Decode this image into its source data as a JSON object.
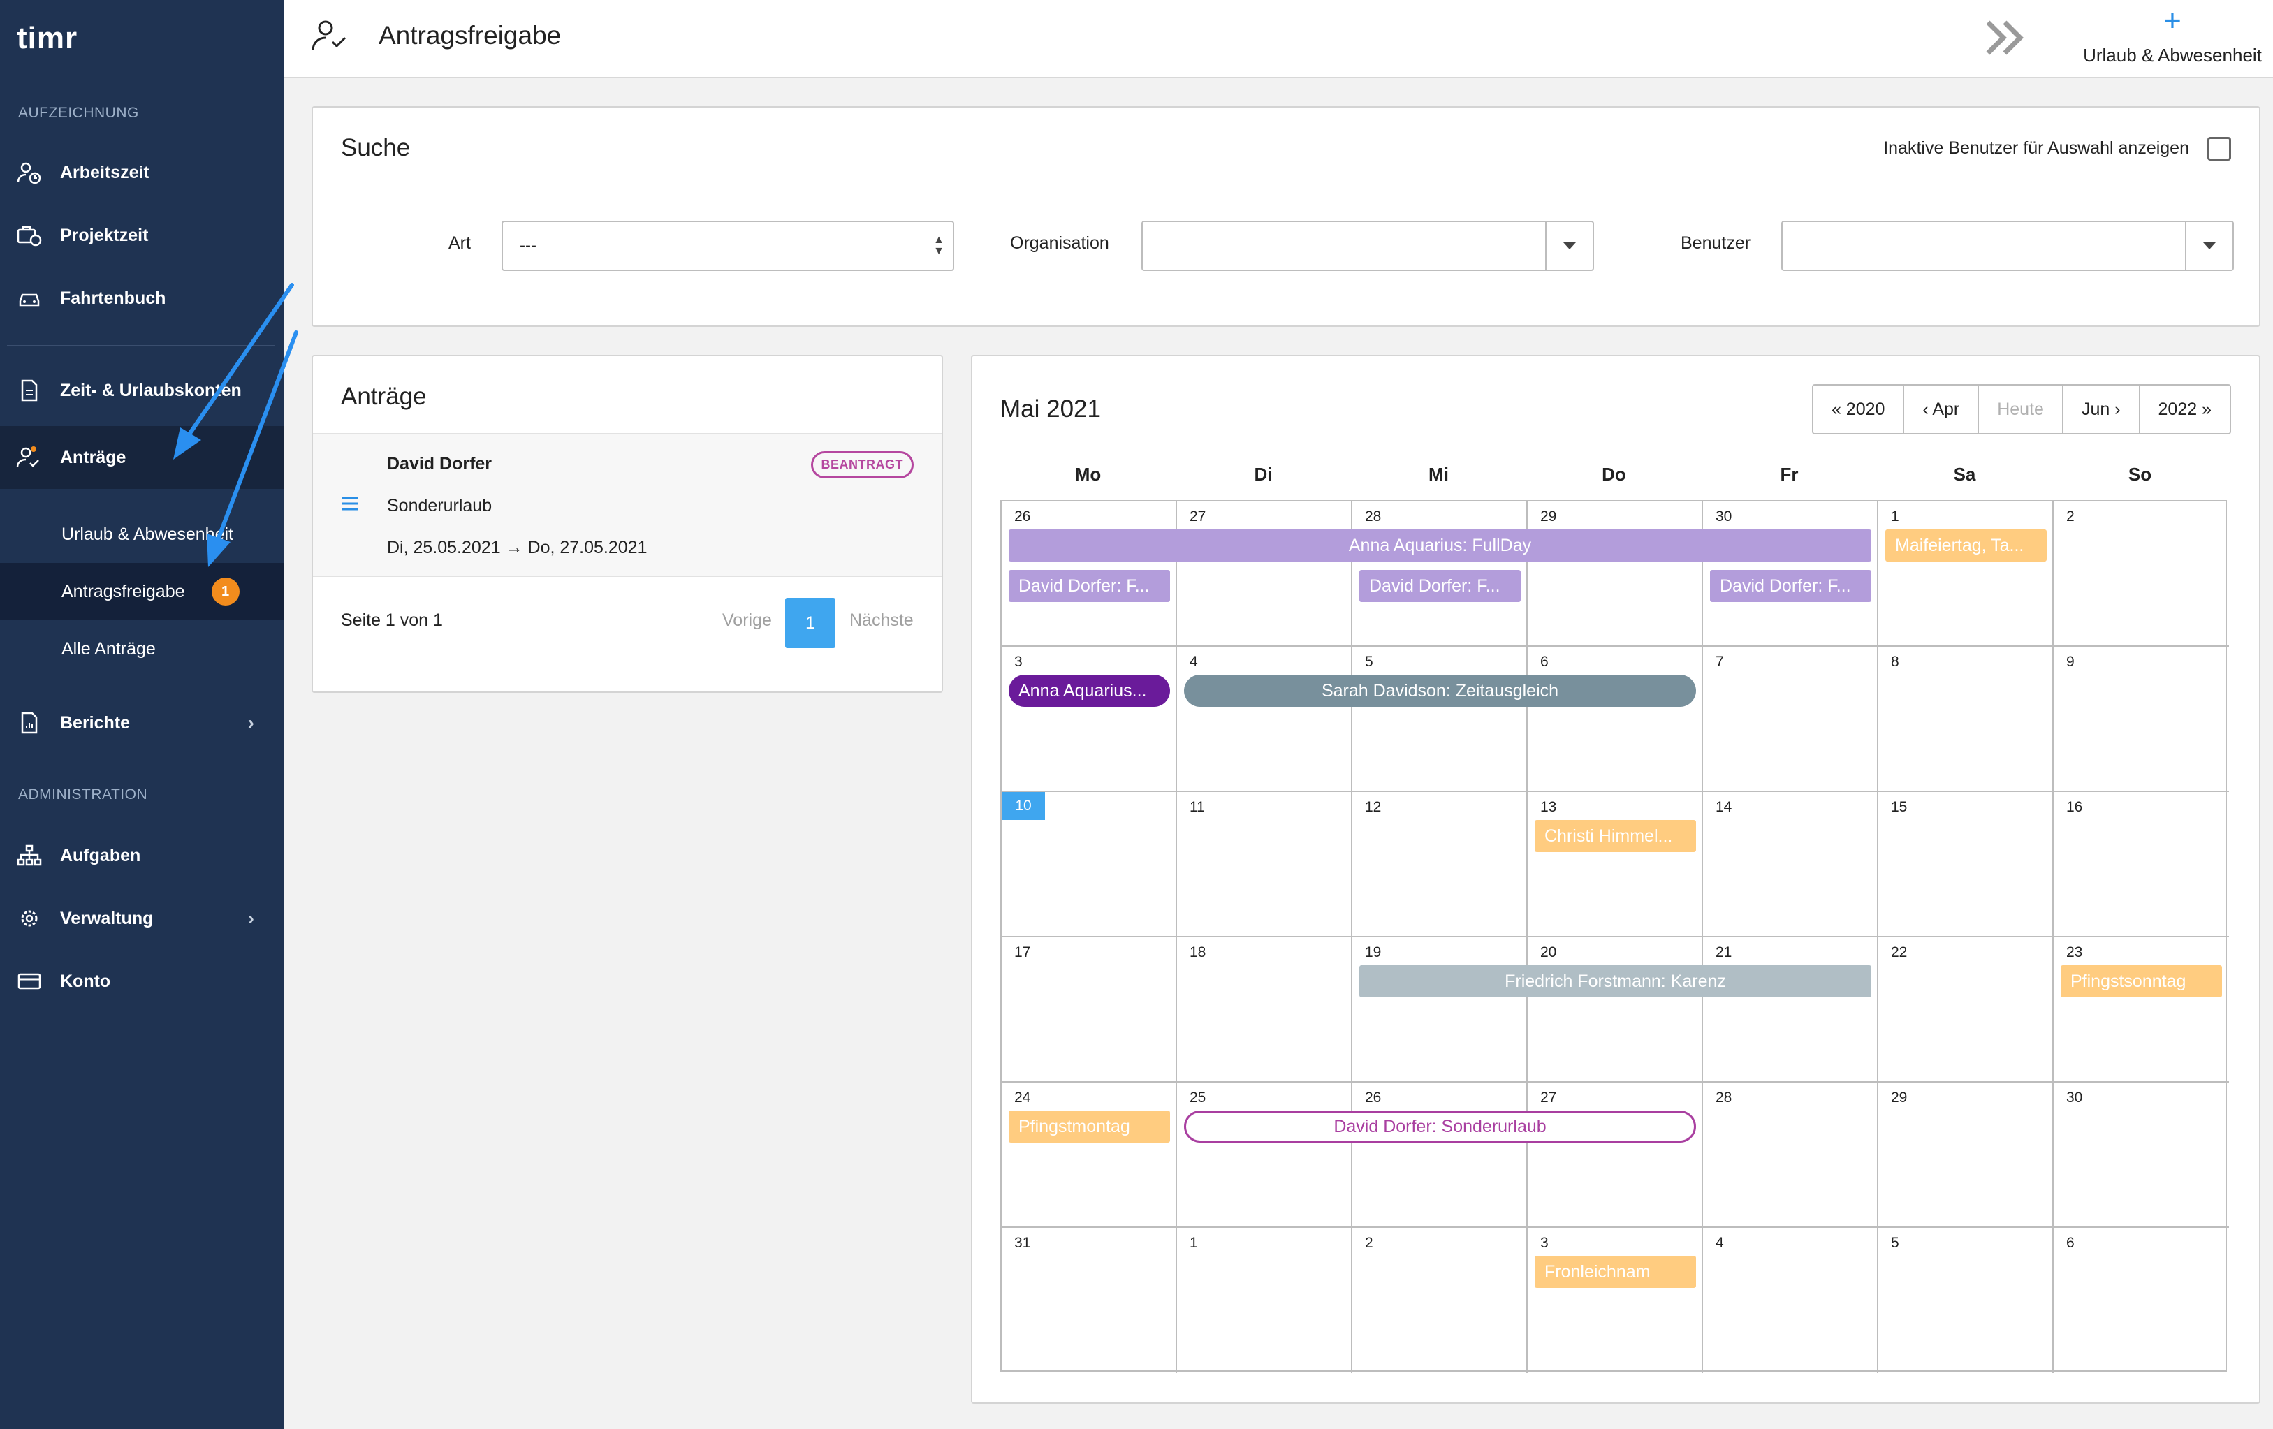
{
  "sidebar": {
    "logo": "timr",
    "section_recording": "AUFZEICHNUNG",
    "section_admin": "ADMINISTRATION",
    "items": {
      "arbeitszeit": "Arbeitszeit",
      "projektzeit": "Projektzeit",
      "fahrtenbuch": "Fahrtenbuch",
      "konten": "Zeit- & Urlaubskonten",
      "antraege": "Anträge",
      "urlaub": "Urlaub & Abwesenheit",
      "antragsfreigabe": "Antragsfreigabe",
      "antragsfreigabe_badge": "1",
      "alle": "Alle Anträge",
      "berichte": "Berichte",
      "aufgaben": "Aufgaben",
      "verwaltung": "Verwaltung",
      "konto": "Konto"
    }
  },
  "topbar": {
    "title": "Antragsfreigabe",
    "add_label": "Urlaub & Abwesenheit",
    "add_icon": "+"
  },
  "search": {
    "title": "Suche",
    "inactive_label": "Inaktive Benutzer für Auswahl anzeigen",
    "art_label": "Art",
    "art_value": "---",
    "org_label": "Organisation",
    "org_value": "",
    "user_label": "Benutzer",
    "user_value": ""
  },
  "requests": {
    "title": "Anträge",
    "item": {
      "name": "David Dorfer",
      "status": "BEANTRAGT",
      "type": "Sonderurlaub",
      "dates": "Di, 25.05.2021 → Do, 27.05.2021"
    },
    "pager": {
      "info": "Seite 1 von 1",
      "prev": "Vorige",
      "current": "1",
      "next": "Nächste"
    }
  },
  "calendar": {
    "title": "Mai 2021",
    "nav": {
      "prev_year": "« 2020",
      "prev_month": "‹ Apr",
      "today": "Heute",
      "next_month": "Jun ›",
      "next_year": "2022 »"
    },
    "weekdays": [
      "Mo",
      "Di",
      "Mi",
      "Do",
      "Fr",
      "Sa",
      "So"
    ],
    "weeks": [
      [
        "26",
        "27",
        "28",
        "29",
        "30",
        "1",
        "2"
      ],
      [
        "3",
        "4",
        "5",
        "6",
        "7",
        "8",
        "9"
      ],
      [
        "10",
        "11",
        "12",
        "13",
        "14",
        "15",
        "16"
      ],
      [
        "17",
        "18",
        "19",
        "20",
        "21",
        "22",
        "23"
      ],
      [
        "24",
        "25",
        "26",
        "27",
        "28",
        "29",
        "30"
      ],
      [
        "31",
        "1",
        "2",
        "3",
        "4",
        "5",
        "6"
      ]
    ],
    "today_label": "10",
    "events": {
      "e1": "Anna Aquarius: FullDay",
      "e2": "Maifeiertag, Ta...",
      "e3": "David Dorfer: F...",
      "e4": "David Dorfer: F...",
      "e5": "David Dorfer: F...",
      "e6": "Anna Aquarius...",
      "e7": "Sarah Davidson: Zeitausgleich",
      "e8": "Christi Himmel...",
      "e9": "Friedrich Forstmann: Karenz",
      "e10": "Pfingstsonntag",
      "e11": "Pfingstmontag",
      "e12": "David Dorfer: Sonderurlaub",
      "e13": "Fronleichnam"
    },
    "colors": {
      "lavender": "#b39ddb",
      "holiday": "#ffcc80",
      "purple": "#6a1b9a",
      "slate": "#78909c",
      "gray": "#b0bec5",
      "outline": "#a93fa0"
    }
  }
}
